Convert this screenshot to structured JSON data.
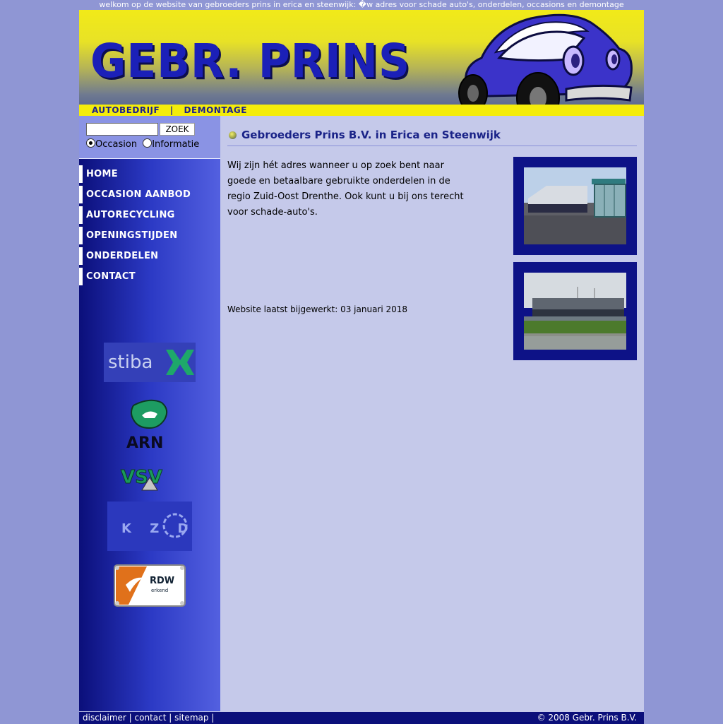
{
  "top_banner": "welkom op de website van gebroeders prins in erica en steenwijk: �w adres voor schade auto's, onderdelen, occasions en demontage",
  "header": {
    "logo": "GEBR. PRINS",
    "tagline_left": "AUTOBEDRIJF",
    "tagline_sep": "|",
    "tagline_right": "DEMONTAGE"
  },
  "search": {
    "input_value": "",
    "button_label": "ZOEK",
    "options": [
      "Occasion",
      "Informatie"
    ],
    "selected": "Occasion"
  },
  "nav": {
    "items": [
      {
        "label": "HOME"
      },
      {
        "label": "OCCASION AANBOD"
      },
      {
        "label": "AUTORECYCLING"
      },
      {
        "label": "OPENINGSTIJDEN"
      },
      {
        "label": "ONDERDELEN"
      },
      {
        "label": "CONTACT"
      }
    ]
  },
  "badges": {
    "stiba": "stiba",
    "arn": "ARN",
    "vsv": "VSV",
    "kzd": "K Z D",
    "rdw": "RDW",
    "rdw_sub": "erkend"
  },
  "main": {
    "title": "Gebroeders Prins B.V. in Erica en Steenwijk",
    "intro": "Wij zijn hét adres wanneer u op zoek bent naar goede en betaalbare gebruikte onderdelen in de regio Zuid-Oost Drenthe. Ook kunt u bij ons terecht voor schade-auto's.",
    "updated": "Website laatst bijgewerkt: 03 januari 2018"
  },
  "footer": {
    "links": [
      "disclaimer",
      "contact",
      "sitemap"
    ],
    "separator": "|",
    "copyright": "© 2008 Gebr. Prins B.V."
  },
  "colors": {
    "page_bg": "#8f96d4",
    "content_bg": "#c5c9ea",
    "nav_dark": "#0b0f7a",
    "title_blue": "#1a2388",
    "header_yellow": "#f4ec0a"
  }
}
